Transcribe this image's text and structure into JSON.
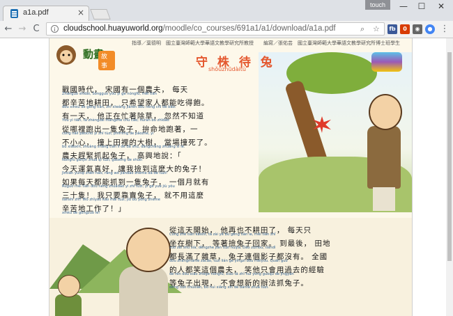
{
  "browser": {
    "tab_title": "a1a.pdf",
    "profile_label": "touch",
    "url_host": "cloudschool.huayuworld.org",
    "url_path": "/moodle/co_courses/691a1/a1/download/a1a.pdf",
    "nav": {
      "back": "←",
      "forward": "→",
      "reload": "C"
    },
    "window": {
      "minimize": "—",
      "maximize": "☐",
      "close": "✕"
    },
    "extensions": [
      "fb",
      "0",
      "◉",
      "●"
    ]
  },
  "page": {
    "brand_title": "動畫",
    "brand_badge": "故事",
    "credits": "指導／葉德明　國立臺灣師範大學華語文教學研究所教授　　編寫／張佑芸　國立臺灣師範大學華語文教學研究所博士班學生",
    "story_title": "守 株 待 兔",
    "story_pinyin": "shǒuzhūdàitù",
    "paragraph1": [
      {
        "cn": "戰國時代， 宋國有一個農夫， 每天",
        "py": "Zhànguó shídài,   Sòngguó yǒu yí ge nóngfū,   měi tiān"
      },
      {
        "cn": "都辛苦地耕田， 只希望家人都能吃得飽。",
        "py": "dōu xīnkǔ de gēng tián,  zhǐ xīwàng jiārén dōu néng chī de bǎo."
      },
      {
        "cn": "有一天， 他正在忙著除草， 忽然不知道",
        "py": "Yǒu yì tiān,   tā zhèngzài mángzhe chú cǎo,   hūrán bù zhīdào"
      },
      {
        "cn": "從哪裡跑出一隻兔子，拚命地跑著，一",
        "py": "cóng nǎlǐ pǎochū yì zhī tùzi,   pīnmìng de pǎozhe,   yí"
      },
      {
        "cn": "不小心， 撞上田裡的大樹， 當場撞死了。",
        "py": "bù xiǎoxīn,  zhuàng shàng tián lǐ de dà shù,  dāngchǎng zhuàng sǐ le."
      },
      {
        "cn": "農夫趕緊抓起兔子， 高興地說：「",
        "py": "Nóngfū gǎnjǐn zhuā qǐ tùzi,   gāoxìng de shuō:"
      },
      {
        "cn": "今天運氣真好，讓我撿到這麼大的兔子！",
        "py": "Jīntiān yùnqì zhēn hǎo,  ràng wǒ jiǎndào zhème dà de tùzi!"
      },
      {
        "cn": "如果每天都能抓到一隻兔子， 一個月就有",
        "py": "Rúguǒ měi tiān dōu néng zhuādào yì zhī tùzi,   yí ge yuè jiù yǒu"
      },
      {
        "cn": "三十隻！ 我只要靠賣兔子， 就不用這麼",
        "py": "sānshí zhī!  Wǒ zhǐyào kào mài tùzi,   jiù bú yòng zhème"
      },
      {
        "cn": "辛苦地工作了！」",
        "py": "xīnkǔ de gōngzuò le!"
      }
    ],
    "paragraph2": [
      {
        "cn": "從這天開始， 他再也不耕田了， 每天只",
        "py": "Cóng zhè tiān kāishǐ,   tā zài yě bù gēng tián le,   měi tiān zhǐ"
      },
      {
        "cn": "坐在樹下， 等著撿兔子回家。 到最後， 田地",
        "py": "zuò zài shù xià,  děngzhe jiǎn tùzi huíjiā.  Dào zuìhòu,  tiándì"
      },
      {
        "cn": "都長滿了雜草， 兔子連個影子都沒有。 全國",
        "py": "dōu zhǎngmǎnle zácǎo,  tùzi lián ge yǐngzi dōu méiyǒu.  Quán guó"
      },
      {
        "cn": "的人都笑這個農夫， 笑他只會用過去的經驗",
        "py": "de rén dōu xiào zhège nóngfū,  xiào tā zhǐ huì yòng guòqù de jīngyàn"
      },
      {
        "cn": "等兔子出現， 不會想新的辦法抓兔子。",
        "py": "děng tùzi chūxiàn,   bú huì xiǎng xīn de bànfǎ zhuā tùzi."
      }
    ]
  }
}
